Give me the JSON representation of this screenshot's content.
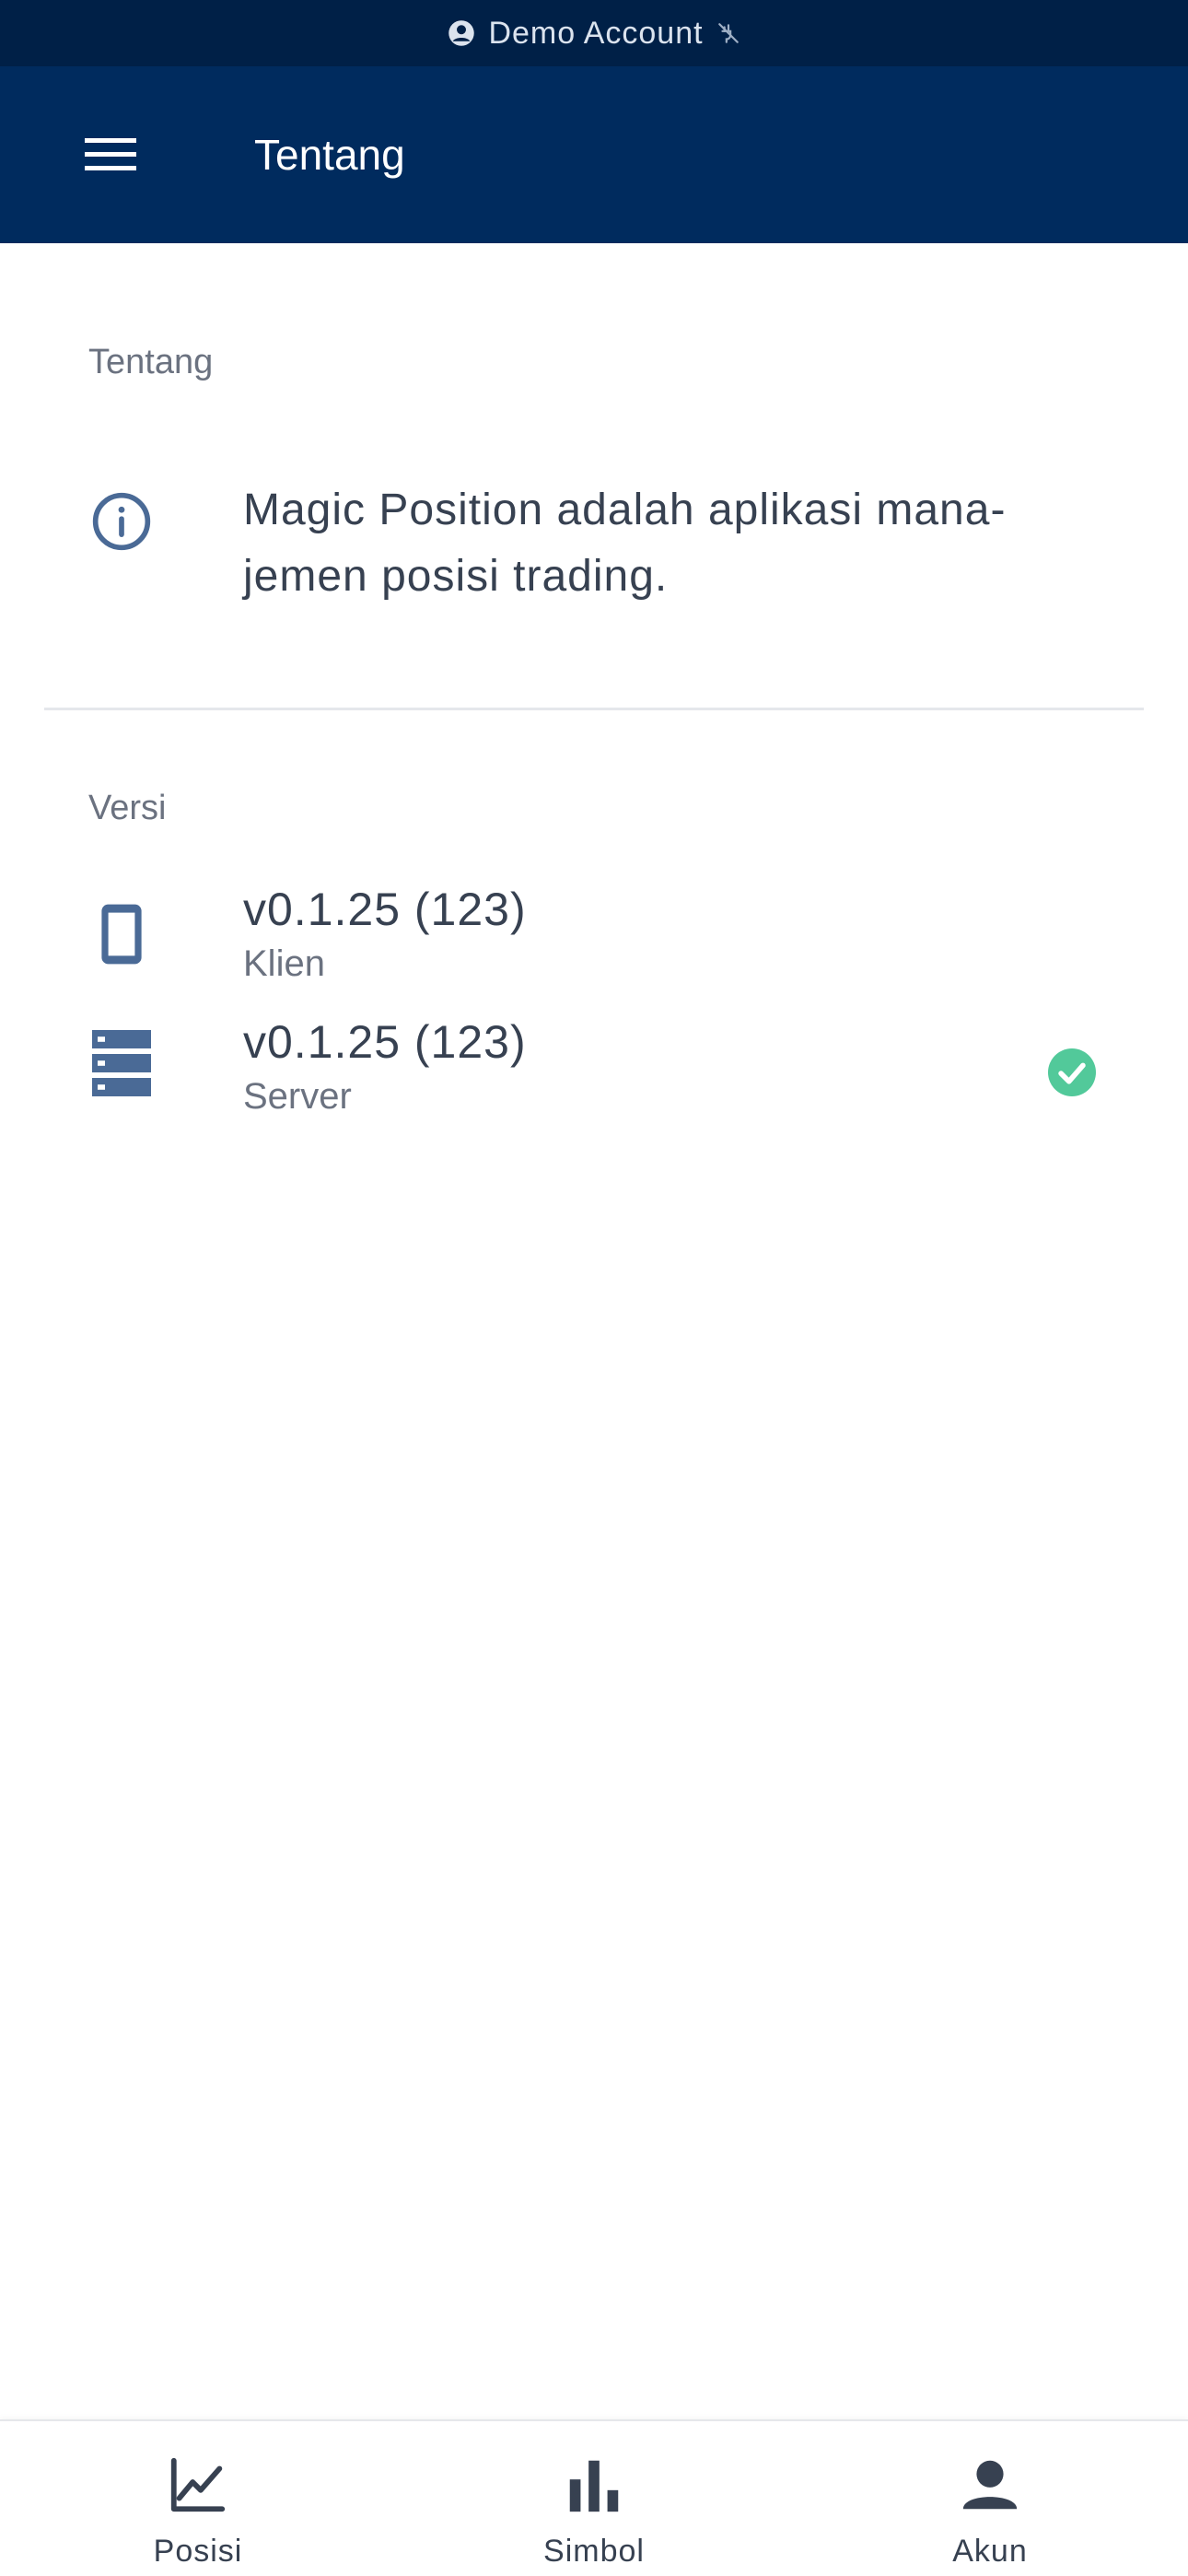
{
  "status_bar": {
    "account_label": "Demo Account",
    "account_icon": "account-circle-icon",
    "connection_icon": "plug-disconnected-icon"
  },
  "app_bar": {
    "title": "Tentang",
    "menu_icon": "hamburger-menu-icon"
  },
  "about": {
    "header": "Tentang",
    "text": "Magic Position adalah aplikasi mana-jemen posisi trading.",
    "icon": "info-icon"
  },
  "versions": {
    "header": "Versi",
    "items": [
      {
        "value": "v0.1.25 (123)",
        "label": "Klien",
        "icon": "phone-icon"
      },
      {
        "value": "v0.1.25 (123)",
        "label": "Server",
        "icon": "server-icon",
        "status_icon": "check-circle-icon"
      }
    ]
  },
  "bottom_nav": {
    "items": [
      {
        "label": "Posisi",
        "icon": "line-chart-icon"
      },
      {
        "label": "Simbol",
        "icon": "bar-chart-icon"
      },
      {
        "label": "Akun",
        "icon": "person-icon"
      }
    ]
  },
  "colors": {
    "status_bar_bg": "#002047",
    "app_bar_bg": "#002b5e",
    "icon_blue": "#4a6a96",
    "success_green": "#52c99a",
    "text_primary": "#374151",
    "text_secondary": "#6b7280"
  }
}
